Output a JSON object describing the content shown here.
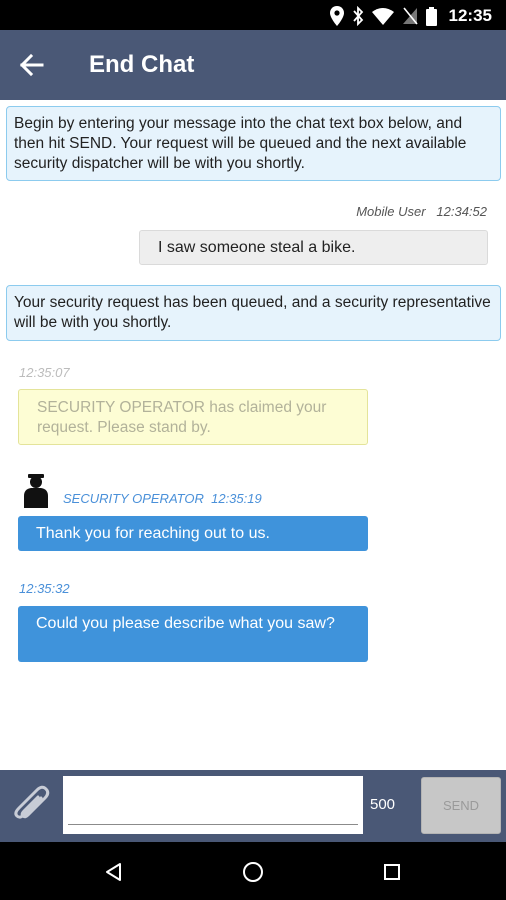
{
  "status_bar": {
    "time": "12:35",
    "icons": [
      "location-icon",
      "bluetooth-icon",
      "wifi-icon",
      "no-sim-icon",
      "battery-icon"
    ]
  },
  "app_bar": {
    "back_icon": "arrow-left-icon",
    "title": "End Chat",
    "color": "#4a5876"
  },
  "chat": {
    "intro": "Begin by entering your message into the chat text box below, and then hit SEND. Your request will be queued and the next available security dispatcher will be with you shortly.",
    "user_sender": "Mobile User",
    "user_time": "12:34:52",
    "user_message": "I saw someone steal a bike.",
    "queued_notice": "Your security request has been queued, and a security representative will be with you shortly.",
    "system_time": "12:35:07",
    "system_message": "SECURITY OPERATOR has claimed your request. Please stand by.",
    "operator_name": "SECURITY OPERATOR",
    "operator_time_1": "12:35:19",
    "operator_message_1": "Thank you for reaching out to us.",
    "operator_time_2": "12:35:32",
    "operator_message_2": "Could you please describe what you saw?"
  },
  "composer": {
    "input_value": "",
    "char_count": "500",
    "send_label": "SEND",
    "attach_icon": "paperclip-icon"
  },
  "nav": {
    "icons": [
      "back-triangle-icon",
      "home-circle-icon",
      "recents-square-icon"
    ]
  },
  "colors": {
    "accent_blue": "#3f93db",
    "info_bg": "#e6f3fc",
    "system_bg": "#fdfdd4"
  }
}
